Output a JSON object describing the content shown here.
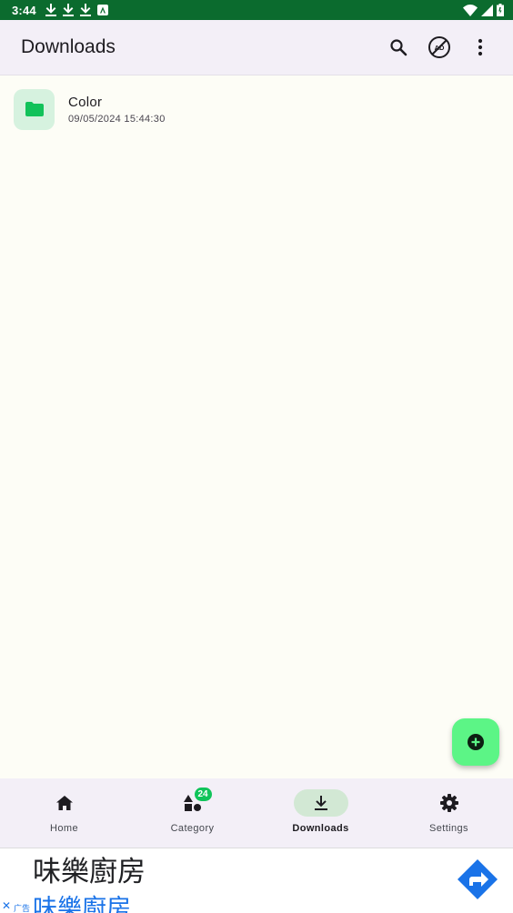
{
  "status_bar": {
    "time": "3:44",
    "notifications": [
      "download-icon",
      "download-icon",
      "download-icon",
      "app-store-icon"
    ],
    "system": [
      "wifi-icon",
      "signal-icon",
      "battery-icon"
    ]
  },
  "app_bar": {
    "title": "Downloads",
    "actions": [
      "search-icon",
      "ad-block-icon",
      "more-vert-icon"
    ]
  },
  "files": [
    {
      "name": "Color",
      "date": "09/05/2024 15:44:30",
      "icon": "folder-icon"
    }
  ],
  "fab": {
    "icon": "add-circle-icon"
  },
  "bottom_nav": {
    "items": [
      {
        "label": "Home",
        "icon": "home-icon",
        "active": false
      },
      {
        "label": "Category",
        "icon": "category-icon",
        "active": false,
        "badge": "24"
      },
      {
        "label": "Downloads",
        "icon": "download-icon",
        "active": true
      },
      {
        "label": "Settings",
        "icon": "settings-icon",
        "active": false
      }
    ]
  },
  "ad": {
    "title": "味樂廚房",
    "subtitle": "味樂廚房",
    "tag": "广告",
    "close": "✕"
  },
  "colors": {
    "status_bar": "#0b6b2e",
    "app_bar": "#f3eff7",
    "background": "#fdfdf6",
    "folder_tile": "#d6f2df",
    "folder_icon": "#12c25a",
    "fab": "#5cf586",
    "nav_active_pill": "#d2e8d4",
    "badge": "#10c45a",
    "ad_link": "#1a73e8"
  }
}
